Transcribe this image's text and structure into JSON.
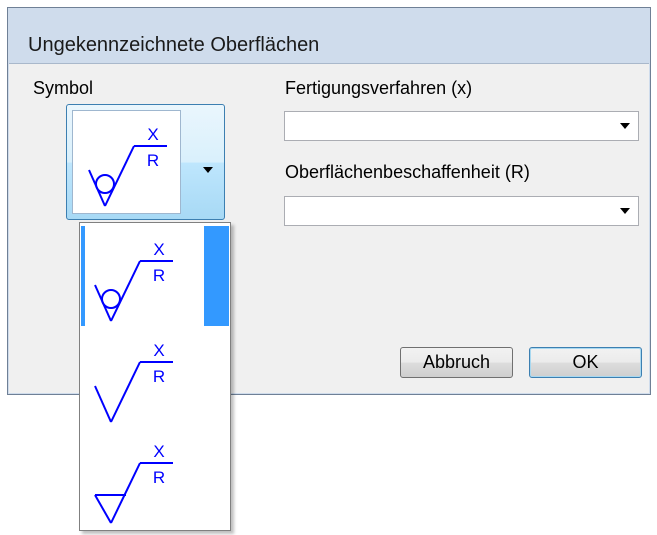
{
  "dialog": {
    "title": "Ungekennzeichnete Oberflächen",
    "symbol_label": "Symbol",
    "field_x_label": "Fertigungsverfahren (x)",
    "field_x_value": "",
    "field_r_label": "Oberflächenbeschaffenheit (R)",
    "field_r_value": "",
    "cancel_label": "Abbruch",
    "ok_label": "OK"
  },
  "symbol": {
    "top_letter": "X",
    "bottom_letter": "R",
    "color": "#0000ff",
    "selected_index": 0,
    "options": [
      {
        "name": "material-removal-prohibited-icon",
        "type": "circle"
      },
      {
        "name": "any-process-permitted-icon",
        "type": "basic"
      },
      {
        "name": "material-removal-required-icon",
        "type": "triangle"
      }
    ]
  },
  "colors": {
    "selection": "#3399ff",
    "button_border": "#3c7fb1"
  }
}
